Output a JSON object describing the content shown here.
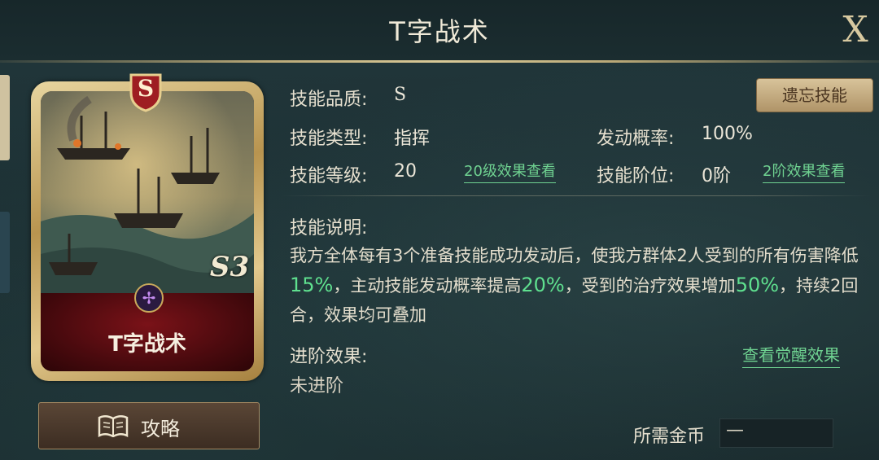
{
  "header": {
    "title": "T字战术",
    "close_label": "X"
  },
  "card": {
    "name": "T字战术",
    "grade": "S",
    "star_level": "S3"
  },
  "guide_button": {
    "label": "攻略",
    "icon": "book-icon"
  },
  "skill": {
    "quality_label": "技能品质:",
    "quality_value": "S",
    "type_label": "技能类型:",
    "type_value": "指挥",
    "level_label": "技能等级:",
    "level_value": "20",
    "level_link": "20级效果查看",
    "trigger_label": "发动概率:",
    "trigger_value": "100%",
    "rank_label": "技能阶位:",
    "rank_value": "0阶",
    "rank_link": "2阶效果查看",
    "forget_button": "遗忘技能"
  },
  "description": {
    "label": "技能说明:",
    "part1": "我方全体每有3个准备技能成功发动后，使我方群体2人受到的所有伤害降低",
    "hl1": "15%",
    "part2": "，主动技能发动概率提高",
    "hl2": "20%",
    "part3": "，受到的治疗效果增加",
    "hl3": "50%",
    "part4": "，持续2回合，效果均可叠加"
  },
  "advance": {
    "label": "进阶效果:",
    "value": "未进阶",
    "link": "查看觉醒效果"
  },
  "cost": {
    "label": "所需金币",
    "value": "—"
  },
  "colors": {
    "highlight": "#5fe08f",
    "gold": "#d7c9a0",
    "card_red": "#7a1218"
  }
}
